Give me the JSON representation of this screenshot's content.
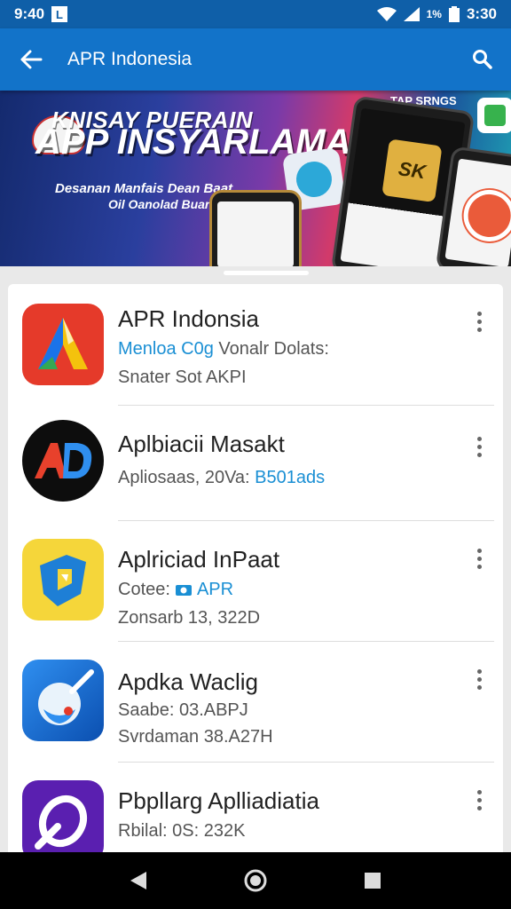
{
  "status_bar": {
    "time_left": "9:40",
    "notification_icon": "L",
    "battery_text": "1%",
    "time_right": "3:30"
  },
  "app_bar": {
    "title": "APR Indonesia",
    "back_icon": "arrow-left",
    "search_icon": "search"
  },
  "banner": {
    "title_top": "KNISAY PUERAIN",
    "title_main": "APP INSYARLAMA",
    "subtitle_1": "Desanan Manfais Dean Baat",
    "subtitle_2": "Oil Oanolad Buanailon",
    "tag": "TAP SRNGS",
    "phone_badge": "SK",
    "colors": {
      "deep_blue": "#142a6e",
      "pink": "#d23a6a",
      "teal": "#1fa6b5"
    }
  },
  "apps": [
    {
      "name": "APR Indonsia",
      "line1_accent": "Menloa C0g",
      "line1_rest": " Vonalr Dolats:",
      "line2": "Snater Sot AKPI",
      "icon": "triangle-a-icon"
    },
    {
      "name": "Aplbiacii Masakt",
      "line1_accent": "",
      "line1_rest": "Apliosaas, 20Va: ",
      "line1_tail": "B501ads",
      "line2": "",
      "icon": "ad-logo-icon"
    },
    {
      "name": "Aplriciad InPaat",
      "line1_accent": "",
      "line1_rest": "Cotee: ",
      "line1_tail": "APR",
      "line2": "Zonsarb 13, 322D",
      "icon": "map-pin-icon"
    },
    {
      "name": "Apdka Waclig",
      "line1_accent": "",
      "line1_rest": "Saabe: 03.ABPJ",
      "line2": "Svrdaman 38.A27H",
      "icon": "tool-orb-icon"
    },
    {
      "name": "Pbpllarg Aplliadiatia",
      "line1_accent": "",
      "line1_rest": "Rbilal: 0S: 232K",
      "line2": "",
      "icon": "purple-swirl-icon"
    }
  ],
  "nav": {
    "back": "back-triangle",
    "home": "home-circle",
    "recents": "recents-square"
  }
}
